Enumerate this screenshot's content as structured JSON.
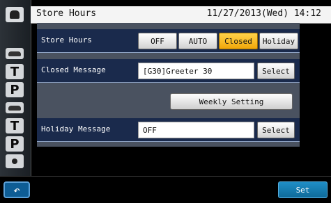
{
  "header": {
    "title": "Store Hours",
    "datetime": "11/27/2013(Wed)   14:12"
  },
  "side_strip": {
    "icons": [
      "home-icon",
      "car-icon",
      "T",
      "P",
      "car-icon",
      "T",
      "P",
      "dot-icon"
    ]
  },
  "store_hours": {
    "label": "Store Hours",
    "options": [
      "OFF",
      "AUTO",
      "Closed",
      "Holiday"
    ],
    "selected": "Closed"
  },
  "closed_message": {
    "label": "Closed Message",
    "value": "[G30]Greeter 30",
    "select_label": "Select"
  },
  "weekly_setting": {
    "label": "Weekly Setting"
  },
  "holiday_message": {
    "label": "Holiday Message",
    "value": "OFF",
    "select_label": "Select"
  },
  "footer": {
    "back_icon": "return-arrow-icon",
    "set_label": "Set"
  },
  "colors": {
    "accent_selected": "#f0a70a",
    "row_bg": "#1a2a4c",
    "panel_bg": "#4a5260",
    "set_button": "#1f8ec6"
  }
}
